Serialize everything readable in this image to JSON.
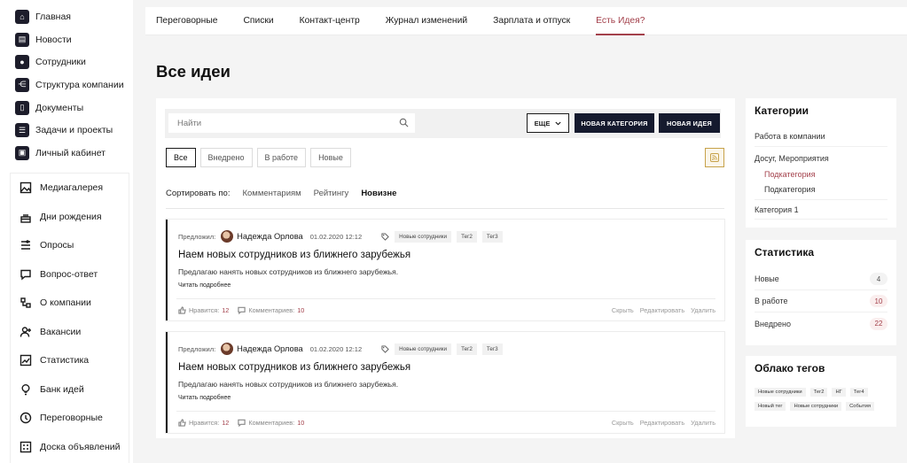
{
  "sidebar": {
    "top_items": [
      {
        "label": "Главная",
        "icon": "home-icon"
      },
      {
        "label": "Новости",
        "icon": "news-icon"
      },
      {
        "label": "Сотрудники",
        "icon": "employees-icon"
      },
      {
        "label": "Структура компании",
        "icon": "structure-icon"
      },
      {
        "label": "Документы",
        "icon": "documents-icon"
      },
      {
        "label": "Задачи и проекты",
        "icon": "tasks-icon"
      },
      {
        "label": "Личный кабинет",
        "icon": "profile-icon"
      }
    ],
    "box_items": [
      {
        "label": "Медиагалерея",
        "icon": "image-icon"
      },
      {
        "label": "Дни рождения",
        "icon": "cake-icon"
      },
      {
        "label": "Опросы",
        "icon": "poll-icon"
      },
      {
        "label": "Вопрос-ответ",
        "icon": "chat-icon"
      },
      {
        "label": "О компании",
        "icon": "company-icon"
      },
      {
        "label": "Вакансии",
        "icon": "add-user-icon"
      },
      {
        "label": "Статистика",
        "icon": "chart-icon"
      },
      {
        "label": "Банк идей",
        "icon": "lightbulb-icon"
      },
      {
        "label": "Переговорные",
        "icon": "meeting-icon"
      },
      {
        "label": "Доска объявлений",
        "icon": "board-icon"
      }
    ]
  },
  "tabs": [
    {
      "label": "Переговорные",
      "active": false
    },
    {
      "label": "Списки",
      "active": false
    },
    {
      "label": "Контакт-центр",
      "active": false
    },
    {
      "label": "Журнал изменений",
      "active": false
    },
    {
      "label": "Зарплата и отпуск",
      "active": false
    },
    {
      "label": "Есть Идея?",
      "active": true
    }
  ],
  "page_title": "Все идеи",
  "toolbar": {
    "search_placeholder": "Найти",
    "more_label": "ЕЩЕ",
    "new_category_label": "НОВАЯ КАТЕГОРИЯ",
    "new_idea_label": "НОВАЯ ИДЕЯ"
  },
  "filters": [
    "Все",
    "Внедрено",
    "В работе",
    "Новые"
  ],
  "sort": {
    "label": "Сортировать по:",
    "options": [
      "Комментариям",
      "Рейтингу",
      "Новизне"
    ],
    "active": "Новизне"
  },
  "ideas": [
    {
      "proposed_label": "Предложил:",
      "author": "Надежда Орлова",
      "date": "01.02.2020 12:12",
      "tags": [
        "Новые сотрудники",
        "Тег2",
        "Тег3"
      ],
      "title": "Наем новых сотрудников из ближнего зарубежья",
      "description": "Предлагаю нанять новых сотрудников из ближнего зарубежья.",
      "read_more": "Читать подробнее",
      "likes_label": "Нравится:",
      "likes": "12",
      "comments_label": "Комментариев:",
      "comments": "10",
      "actions": [
        "Скрыть",
        "Редактировать",
        "Удалить"
      ]
    },
    {
      "proposed_label": "Предложил:",
      "author": "Надежда Орлова",
      "date": "01.02.2020 12:12",
      "tags": [
        "Новые сотрудники",
        "Тег2",
        "Тег3"
      ],
      "title": "Наем новых сотрудников из ближнего зарубежья",
      "description": "Предлагаю нанять новых сотрудников из ближнего зарубежья.",
      "read_more": "Читать подробнее",
      "likes_label": "Нравится:",
      "likes": "12",
      "comments_label": "Комментариев:",
      "comments": "10",
      "actions": [
        "Скрыть",
        "Редактировать",
        "Удалить"
      ]
    }
  ],
  "categories": {
    "title": "Категории",
    "items": [
      "Работа в компании",
      "Досуг, Мероприятия"
    ],
    "subitems": [
      "Подкатегория",
      "Подкатегория"
    ],
    "last": "Категория 1"
  },
  "stats": {
    "title": "Статистика",
    "rows": [
      {
        "label": "Новые",
        "value": "4"
      },
      {
        "label": "В работе",
        "value": "10"
      },
      {
        "label": "Внедрено",
        "value": "22"
      }
    ]
  },
  "tag_cloud": {
    "title": "Облако тегов",
    "tags": [
      "Новые сотрудники",
      "Тег2",
      "НГ",
      "Тег4",
      "Новый тег",
      "Новые сотрудники",
      "События"
    ]
  },
  "colors": {
    "accent": "#a3404b",
    "dark_button": "#151a2e",
    "rss": "#c7a24a"
  }
}
